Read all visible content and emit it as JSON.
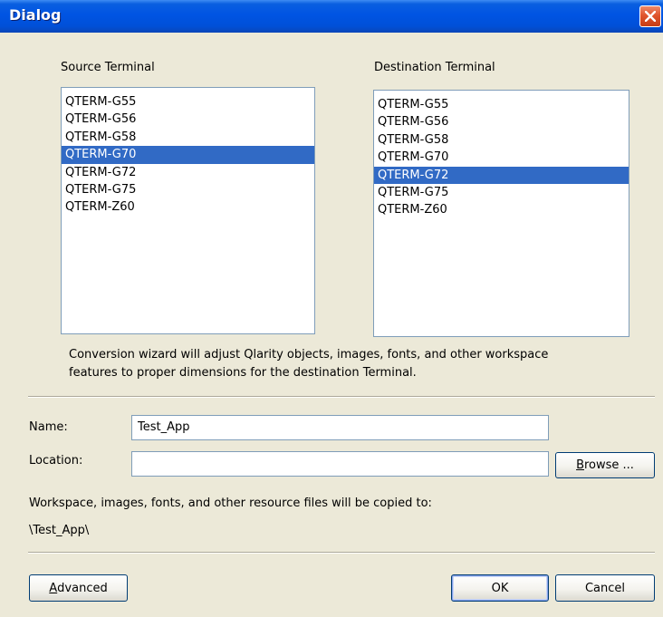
{
  "window": {
    "title": "Dialog"
  },
  "source": {
    "label": "Source Terminal",
    "items": [
      "QTERM-G55",
      "QTERM-G56",
      "QTERM-G58",
      "QTERM-G70",
      "QTERM-G72",
      "QTERM-G75",
      "QTERM-Z60"
    ],
    "selected": "QTERM-G70"
  },
  "destination": {
    "label": "Destination Terminal",
    "items": [
      "QTERM-G55",
      "QTERM-G56",
      "QTERM-G58",
      "QTERM-G70",
      "QTERM-G72",
      "QTERM-G75",
      "QTERM-Z60"
    ],
    "selected": "QTERM-G72"
  },
  "info_text": {
    "line1": "Conversion wizard will adjust Qlarity objects, images, fonts, and other workspace",
    "line2": "features to proper dimensions for the destination Terminal."
  },
  "name": {
    "label": "Name:",
    "value": "Test_App"
  },
  "location": {
    "label": "Location:",
    "value": ""
  },
  "browse_button": {
    "mnemonic": "B",
    "rest": "rowse ..."
  },
  "copy_note": "Workspace, images, fonts, and other resource files will be copied to:",
  "copy_path": "\\Test_App\\",
  "advanced_button": {
    "mnemonic": "A",
    "rest": "dvanced"
  },
  "ok_button": {
    "label": "OK"
  },
  "cancel_button": {
    "label": "Cancel"
  },
  "colors": {
    "titlebar": "#0054e3",
    "selection": "#316ac5",
    "dialog_bg": "#ece9d8"
  }
}
